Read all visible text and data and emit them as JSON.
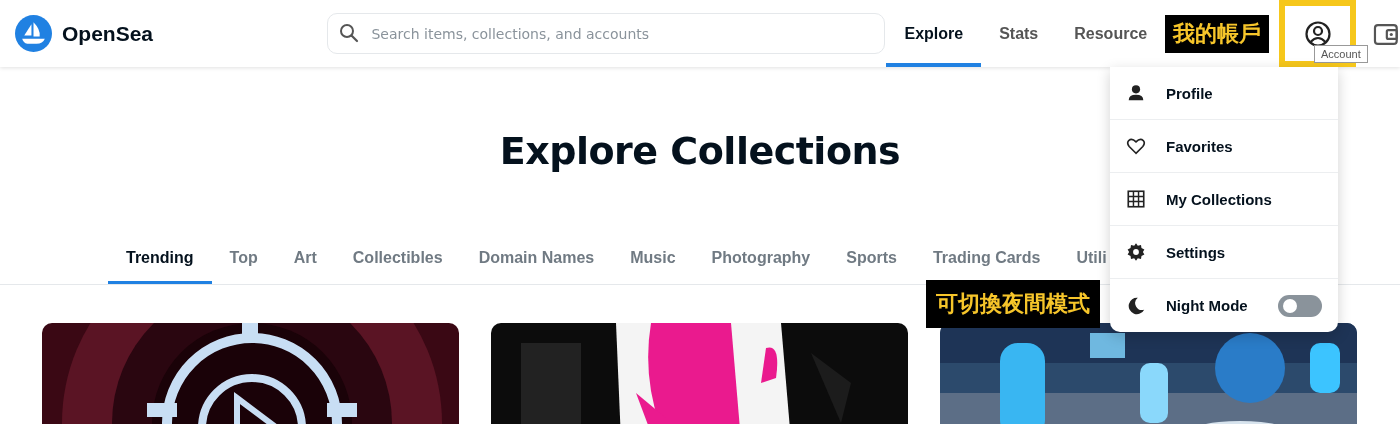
{
  "header": {
    "logo": "OpenSea",
    "search": {
      "placeholder": "Search items, collections, and accounts"
    },
    "nav": [
      {
        "label": "Explore",
        "selected": true
      },
      {
        "label": "Stats",
        "selected": false
      },
      {
        "label": "Resource",
        "selected": false
      }
    ],
    "tooltip": "Account"
  },
  "annotations": [
    "我的帳戶",
    "可切換夜間模式"
  ],
  "title": "Explore Collections",
  "categories": [
    {
      "label": "Trending",
      "selected": true
    },
    {
      "label": "Top",
      "selected": false
    },
    {
      "label": "Art",
      "selected": false
    },
    {
      "label": "Collectibles",
      "selected": false
    },
    {
      "label": "Domain Names",
      "selected": false
    },
    {
      "label": "Music",
      "selected": false
    },
    {
      "label": "Photography",
      "selected": false
    },
    {
      "label": "Sports",
      "selected": false
    },
    {
      "label": "Trading Cards",
      "selected": false
    },
    {
      "label": "Utili",
      "selected": false
    }
  ],
  "account_menu": [
    {
      "kind": "link",
      "label": "Profile"
    },
    {
      "kind": "link",
      "label": "Favorites"
    },
    {
      "kind": "link",
      "label": "My Collections"
    },
    {
      "kind": "link",
      "label": "Settings"
    },
    {
      "kind": "toggle",
      "label": "Night Mode",
      "on": false
    }
  ],
  "cards": [
    {
      "kind": "picture"
    },
    {
      "kind": "picture"
    },
    {
      "kind": "picture"
    }
  ]
}
